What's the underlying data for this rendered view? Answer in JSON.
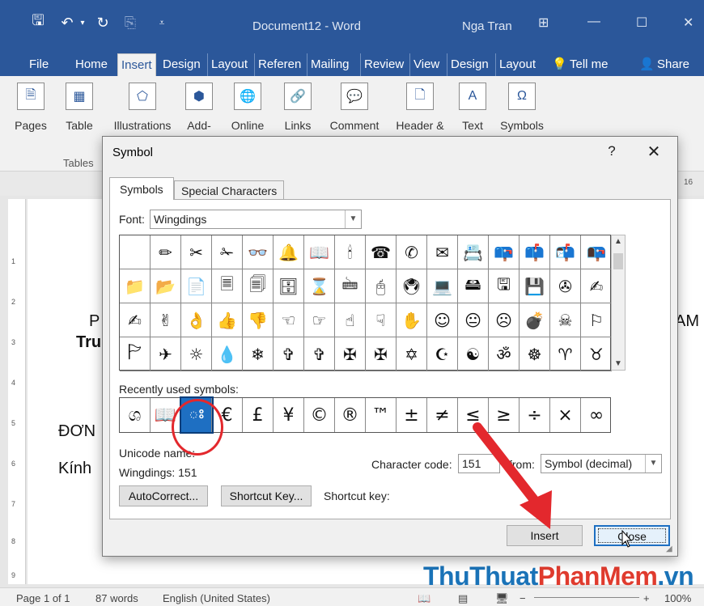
{
  "window": {
    "doc_title": "Document12 - Word",
    "user_name": "Nga Tran"
  },
  "tabs": [
    {
      "label": "File"
    },
    {
      "label": "Home"
    },
    {
      "label": "Insert"
    },
    {
      "label": "Design"
    },
    {
      "label": "Layout"
    },
    {
      "label": "Referen"
    },
    {
      "label": "Mailing"
    },
    {
      "label": "Review"
    },
    {
      "label": "View"
    },
    {
      "label": "Design"
    },
    {
      "label": "Layout"
    },
    {
      "label": "Tell me"
    },
    {
      "label": "Share"
    }
  ],
  "ribbon": {
    "pages": "Pages",
    "table": "Table",
    "illustrations": "Illustrations",
    "addins": "Add-",
    "online": "Online",
    "links": "Links",
    "comment": "Comment",
    "header": "Header &",
    "text": "Text",
    "symbols": "Symbols",
    "tables_group": "Tables"
  },
  "ruler": {
    "right_marker": "16",
    "vertical_marks": [
      "1",
      "2",
      "3",
      "4",
      "5",
      "6",
      "7",
      "8",
      "9"
    ]
  },
  "document": {
    "frag_p": "P",
    "frag_tru": "Tru",
    "frag_am": "AM",
    "frag_don": "ĐƠN",
    "frag_kinh": "Kính"
  },
  "dialog": {
    "title": "Symbol",
    "help": "?",
    "close": "✕",
    "tab_symbols": "Symbols",
    "tab_special": "Special Characters",
    "font_label": "Font:",
    "font_value": "Wingdings",
    "symbols": [
      "",
      "✏",
      "✂",
      "✁",
      "👓",
      "🔔",
      "📖",
      "🕯",
      "☎",
      "✆",
      "✉",
      "📇",
      "📪",
      "📫",
      "📬",
      "📭",
      "📁",
      "📂",
      "📄",
      "🗏",
      "🗐",
      "🗄",
      "⌛",
      "🖮",
      "🖰",
      "🖲",
      "💻",
      "🖴",
      "🖫",
      "💾",
      "✇",
      "✍",
      "✍",
      "✌",
      "👌",
      "👍",
      "👎",
      "☜",
      "☞",
      "☝",
      "☟",
      "✋",
      "☺",
      "😐",
      "☹",
      "💣",
      "☠",
      "⚐",
      "🏱",
      "✈",
      "☼",
      "💧",
      "❄",
      "✞",
      "✞",
      "✠",
      "✠",
      "✡",
      "☪",
      "☯",
      "ॐ",
      "☸",
      "♈",
      "♉"
    ],
    "recent_label": "Recently used symbols:",
    "recent": [
      "ශ",
      "📖",
      "ః",
      "€",
      "£",
      "¥",
      "©",
      "®",
      "™",
      "±",
      "≠",
      "≤",
      "≥",
      "÷",
      "×",
      "∞"
    ],
    "unicode_name_label": "Unicode name:",
    "unicode_name_value": "Wingdings: 151",
    "charcode_label": "Character code:",
    "charcode_value": "151",
    "from_label": "from:",
    "from_value": "Symbol (decimal)",
    "autocorrect_btn": "AutoCorrect...",
    "shortcut_btn": "Shortcut Key...",
    "shortcut_label": "Shortcut key:",
    "insert_btn": "Insert",
    "close_btn": "Close"
  },
  "statusbar": {
    "page": "Page 1 of 1",
    "words": "87 words",
    "language": "English (United States)",
    "zoom": "100%"
  },
  "watermark": {
    "part1": "ThuThuat",
    "part2": "PhanMem",
    "part3": ".vn"
  },
  "colors": {
    "word_blue": "#2b579a",
    "selection_blue": "#1e6fc2",
    "highlight_red": "#e3282d"
  }
}
